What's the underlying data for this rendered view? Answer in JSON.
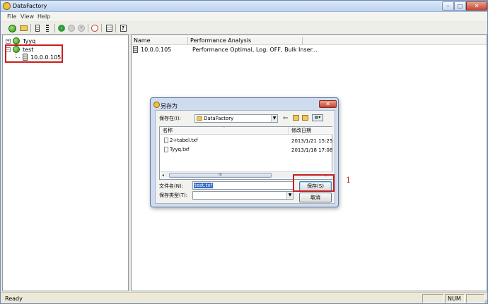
{
  "window": {
    "title": "DataFactory"
  },
  "menu": [
    "File",
    "View",
    "Help"
  ],
  "toolbar": {
    "buttons": [
      "connect-icon",
      "open-folder-icon",
      "properties-icon",
      "columns-icon",
      "go-icon",
      "pause-icon",
      "stop-icon",
      "timer-icon",
      "document-icon",
      "help-icon"
    ]
  },
  "tree": {
    "items": [
      {
        "label": "Tyyq",
        "expander": "+"
      },
      {
        "label": "test",
        "expander": "−"
      },
      {
        "label": "10.0.0.105"
      }
    ]
  },
  "list": {
    "columns": [
      "Name",
      "Performance Analysis"
    ],
    "rows": [
      {
        "name": "10.0.0.105",
        "analysis": "Performance Optimal, Log: OFF, Bulk Inser..."
      }
    ]
  },
  "dialog": {
    "title": "另存为",
    "close_label": "✕",
    "save_in_label": "保存在(I):",
    "save_in_value": "DataFactory",
    "columns": [
      "名称",
      "修改日期"
    ],
    "files": [
      {
        "name": "2+tabel.txf",
        "date": "2013/1/21 15:25"
      },
      {
        "name": "Tyyq.txf",
        "date": "2013/1/18 17:08"
      }
    ],
    "filename_label": "文件名(N):",
    "filename_value": "test.txf",
    "filetype_label": "保存类型(T):",
    "filetype_value": "",
    "save_button": "保存(S)",
    "cancel_button": "取消",
    "scroll_grip": "III"
  },
  "annotation": {
    "marker": "1"
  },
  "status": {
    "text": "Ready",
    "num": "NUM"
  },
  "colors": {
    "highlight_box": "#cc1d1d",
    "selection": "#316ac5"
  }
}
